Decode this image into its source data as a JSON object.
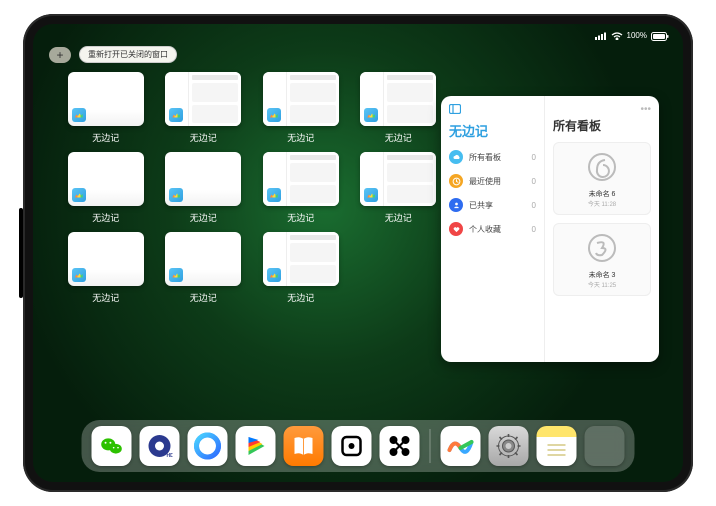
{
  "status": {
    "time": "",
    "battery_text": "100%"
  },
  "top": {
    "plus": "+",
    "reopen": "重新打开已关闭的窗口"
  },
  "tiles": {
    "label": "无边记",
    "count": 11
  },
  "right_window": {
    "sidebar_title": "无边记",
    "items": [
      {
        "label": "所有看板",
        "count": "0",
        "color": "cloud"
      },
      {
        "label": "最近使用",
        "count": "0",
        "color": "clock"
      },
      {
        "label": "已共享",
        "count": "0",
        "color": "share"
      },
      {
        "label": "个人收藏",
        "count": "0",
        "color": "heart"
      }
    ],
    "right_title": "所有看板",
    "boards": [
      {
        "name": "未命名 6",
        "sub": "今天 11:28",
        "sketch": "6"
      },
      {
        "name": "未命名 3",
        "sub": "今天 11:25",
        "sketch": "3"
      }
    ]
  },
  "dock": {
    "items": [
      "wechat",
      "oround",
      "qq",
      "play",
      "books",
      "dice",
      "nodes"
    ],
    "recents": [
      "freeform",
      "settings",
      "notes",
      "multi"
    ]
  }
}
